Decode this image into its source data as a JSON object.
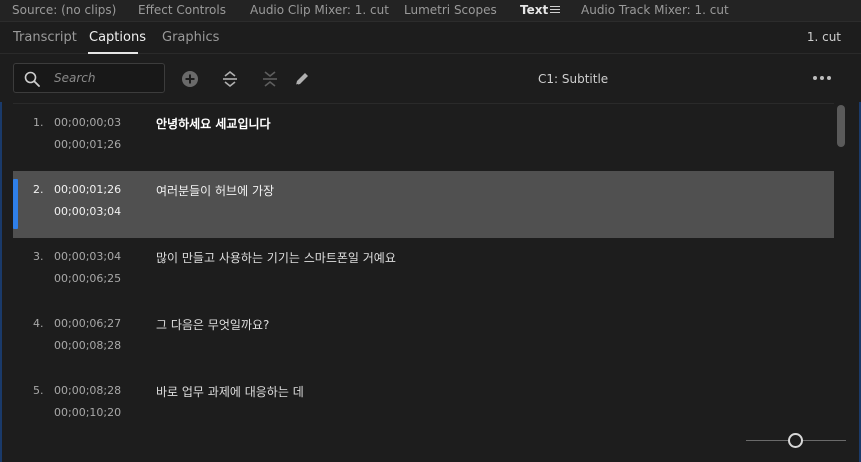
{
  "panel_tabs": [
    {
      "label": "Source: (no clips)",
      "active": false
    },
    {
      "label": "Effect Controls",
      "active": false
    },
    {
      "label": "Audio Clip Mixer: 1. cut",
      "active": false
    },
    {
      "label": "Lumetri Scopes",
      "active": false
    },
    {
      "label": "Text",
      "active": true
    },
    {
      "label": "Audio Track Mixer: 1. cut",
      "active": false
    }
  ],
  "sub_tabs": [
    {
      "label": "Transcript",
      "active": false
    },
    {
      "label": "Captions",
      "active": true
    },
    {
      "label": "Graphics",
      "active": false
    }
  ],
  "sequence_name": "1. cut",
  "toolbar": {
    "search_placeholder": "Search",
    "track_label": "C1: Subtitle",
    "icons": [
      "add-caption-icon",
      "split-caption-icon",
      "merge-captions-icon",
      "pencil-icon",
      "more-options-icon"
    ]
  },
  "captions": [
    {
      "num": "1.",
      "in": "00;00;00;03",
      "out": "00;00;01;26",
      "text": "안녕하세요     세교입니다",
      "selected": false
    },
    {
      "num": "2.",
      "in": "00;00;01;26",
      "out": "00;00;03;04",
      "text": "여러분들이 허브에 가장",
      "selected": true
    },
    {
      "num": "3.",
      "in": "00;00;03;04",
      "out": "00;00;06;25",
      "text": "많이 만들고 사용하는 기기는 스마트폰일 거예요",
      "selected": false
    },
    {
      "num": "4.",
      "in": "00;00;06;27",
      "out": "00;00;08;28",
      "text": "그 다음은 무엇일까요?",
      "selected": false
    },
    {
      "num": "5.",
      "in": "00;00;08;28",
      "out": "00;00;10;20",
      "text": "바로 업무 과제에 대응하는 데",
      "selected": false
    }
  ],
  "colors": {
    "accent": "#2f7fe8",
    "selected_row": "#505050",
    "background": "#1d1d1d"
  },
  "zoom_level": 0.5
}
